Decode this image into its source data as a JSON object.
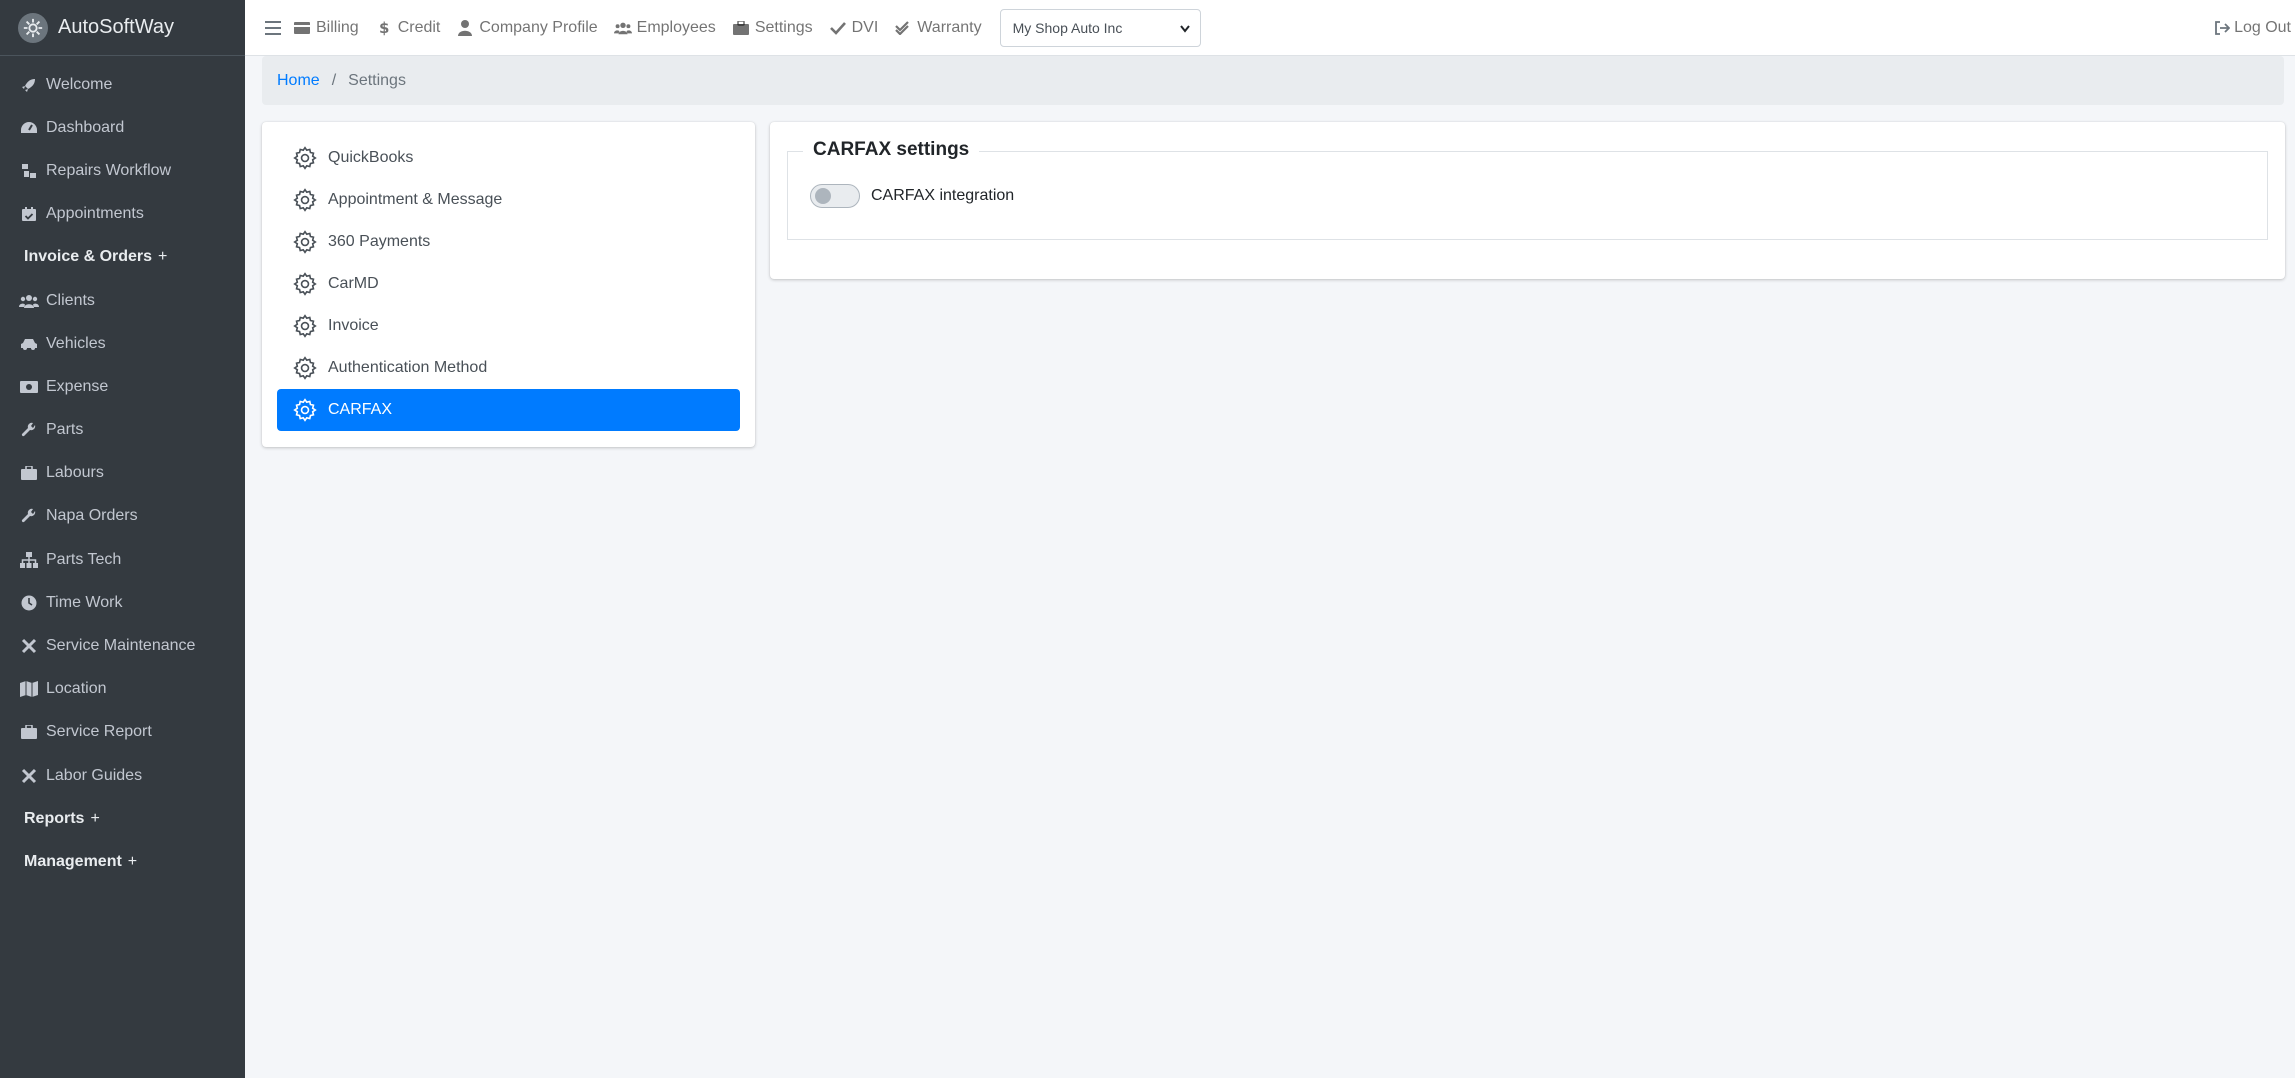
{
  "brand": {
    "name": "AutoSoftWay",
    "icon": "logo-icon"
  },
  "sidebar": {
    "items": [
      {
        "label": "Welcome",
        "icon": "rocket-icon",
        "type": "link"
      },
      {
        "label": "Dashboard",
        "icon": "tachometer-icon",
        "type": "link"
      },
      {
        "label": "Repairs Workflow",
        "icon": "workflow-icon",
        "type": "link"
      },
      {
        "label": "Appointments",
        "icon": "calendar-check-icon",
        "type": "link"
      },
      {
        "label": "Invoice & Orders",
        "expander": "+",
        "type": "header"
      },
      {
        "label": "Clients",
        "icon": "users-icon",
        "type": "link"
      },
      {
        "label": "Vehicles",
        "icon": "car-icon",
        "type": "link"
      },
      {
        "label": "Expense",
        "icon": "money-bill-icon",
        "type": "link"
      },
      {
        "label": "Parts",
        "icon": "wrench-icon",
        "type": "link"
      },
      {
        "label": "Labours",
        "icon": "briefcase-icon",
        "type": "link"
      },
      {
        "label": "Napa Orders",
        "icon": "wrench-icon",
        "type": "link"
      },
      {
        "label": "Parts Tech",
        "icon": "sitemap-icon",
        "type": "link"
      },
      {
        "label": "Time Work",
        "icon": "clock-icon",
        "type": "link"
      },
      {
        "label": "Service Maintenance",
        "icon": "tools-icon",
        "type": "link"
      },
      {
        "label": "Location",
        "icon": "map-icon",
        "type": "link"
      },
      {
        "label": "Service Report",
        "icon": "briefcase-icon",
        "type": "link"
      },
      {
        "label": "Labor Guides",
        "icon": "tools-icon",
        "type": "link"
      },
      {
        "label": "Reports",
        "expander": "+",
        "type": "header"
      },
      {
        "label": "Management",
        "expander": "+",
        "type": "header"
      }
    ]
  },
  "topbar": {
    "links": [
      {
        "label": "Billing",
        "icon": "billing-icon"
      },
      {
        "label": "Credit",
        "icon": "dollar-icon"
      },
      {
        "label": "Company Profile",
        "icon": "user-icon"
      },
      {
        "label": "Employees",
        "icon": "users-icon"
      },
      {
        "label": "Settings",
        "icon": "briefcase-icon"
      },
      {
        "label": "DVI",
        "icon": "check-icon"
      },
      {
        "label": "Warranty",
        "icon": "double-check-icon"
      }
    ],
    "shop_select": {
      "value": "My Shop Auto Inc"
    },
    "logout_label": "Log Out"
  },
  "breadcrumb": {
    "home": "Home",
    "separator": "/",
    "current": "Settings"
  },
  "settings_menu": {
    "items": [
      {
        "label": "QuickBooks",
        "active": false
      },
      {
        "label": "Appointment & Message",
        "active": false
      },
      {
        "label": "360 Payments",
        "active": false
      },
      {
        "label": "CarMD",
        "active": false
      },
      {
        "label": "Invoice",
        "active": false
      },
      {
        "label": "Authentication Method",
        "active": false
      },
      {
        "label": "CARFAX",
        "active": true
      }
    ]
  },
  "carfax": {
    "legend": "CARFAX settings",
    "toggle_label": "CARFAX integration",
    "enabled": false
  },
  "colors": {
    "sidebar_bg": "#343a40",
    "accent": "#007bff",
    "page_bg": "#f4f6f9"
  }
}
